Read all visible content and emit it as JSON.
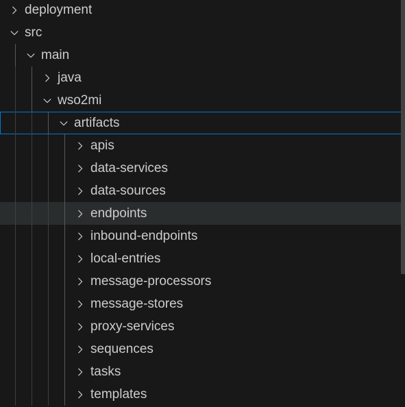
{
  "tree": [
    {
      "label": "deployment",
      "depth": 0,
      "expanded": false
    },
    {
      "label": "src",
      "depth": 0,
      "expanded": true
    },
    {
      "label": "main",
      "depth": 1,
      "expanded": true
    },
    {
      "label": "java",
      "depth": 2,
      "expanded": false
    },
    {
      "label": "wso2mi",
      "depth": 2,
      "expanded": true
    },
    {
      "label": "artifacts",
      "depth": 3,
      "expanded": true,
      "state": "focused"
    },
    {
      "label": "apis",
      "depth": 4,
      "expanded": false
    },
    {
      "label": "data-services",
      "depth": 4,
      "expanded": false
    },
    {
      "label": "data-sources",
      "depth": 4,
      "expanded": false
    },
    {
      "label": "endpoints",
      "depth": 4,
      "expanded": false,
      "state": "hovered"
    },
    {
      "label": "inbound-endpoints",
      "depth": 4,
      "expanded": false
    },
    {
      "label": "local-entries",
      "depth": 4,
      "expanded": false
    },
    {
      "label": "message-processors",
      "depth": 4,
      "expanded": false
    },
    {
      "label": "message-stores",
      "depth": 4,
      "expanded": false
    },
    {
      "label": "proxy-services",
      "depth": 4,
      "expanded": false
    },
    {
      "label": "sequences",
      "depth": 4,
      "expanded": false
    },
    {
      "label": "tasks",
      "depth": 4,
      "expanded": false
    },
    {
      "label": "templates",
      "depth": 4,
      "expanded": false
    }
  ],
  "icons": {
    "collapsed": "chevron-right-icon",
    "expanded": "chevron-down-icon"
  },
  "colors": {
    "background": "#181818",
    "text": "#cccccc",
    "hover": "#2a2d2e",
    "focus_border": "#0078d4",
    "indent_guide": "#585858",
    "scrollbar": "#424242"
  }
}
